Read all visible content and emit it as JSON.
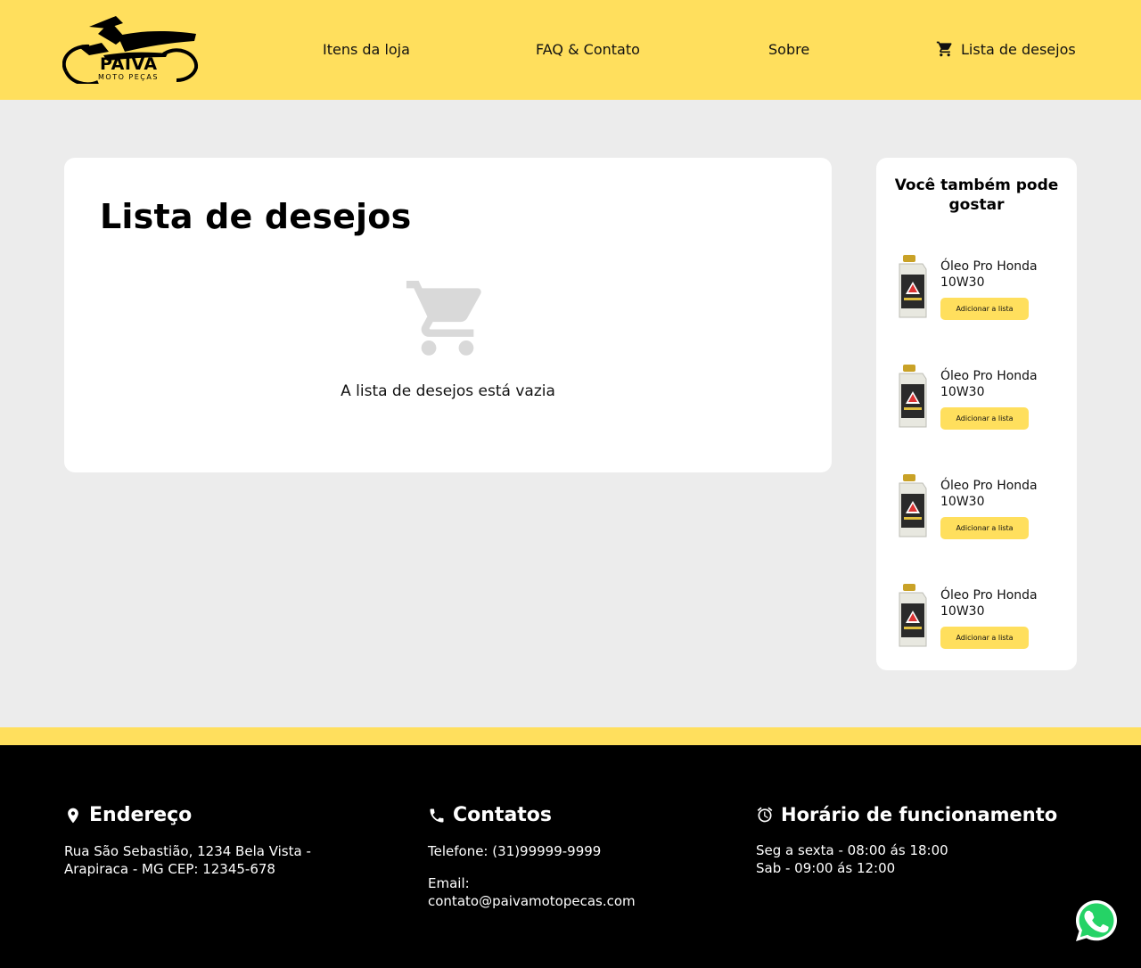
{
  "header": {
    "logo_text": "PAIVA",
    "logo_subtext": "MOTO PEÇAS",
    "nav": [
      {
        "label": "Itens da loja"
      },
      {
        "label": "FAQ & Contato"
      },
      {
        "label": "Sobre"
      },
      {
        "label": "Lista de desejos",
        "icon": "cart-icon"
      }
    ]
  },
  "main": {
    "title": "Lista de desejos",
    "empty_icon": "cart-icon",
    "empty_message": "A lista de desejos está vazia"
  },
  "sidebar": {
    "title": "Você também pode gostar",
    "products": [
      {
        "name": "Óleo Pro Honda 10W30",
        "button": "Adicionar a lista"
      },
      {
        "name": "Óleo Pro Honda 10W30",
        "button": "Adicionar a lista"
      },
      {
        "name": "Óleo Pro Honda 10W30",
        "button": "Adicionar a lista"
      },
      {
        "name": "Óleo Pro Honda 10W30",
        "button": "Adicionar a lista"
      }
    ]
  },
  "footer": {
    "address": {
      "icon": "location-pin-icon",
      "title": "Endereço",
      "text": "Rua São Sebastião, 1234 Bela Vista - Arapiraca - MG CEP: 12345-678"
    },
    "contacts": {
      "icon": "phone-icon",
      "title": "Contatos",
      "phone": "Telefone: (31)99999-9999",
      "email_label": "Email:",
      "email": "contato@paivamotopecas.com"
    },
    "hours": {
      "icon": "alarm-clock-icon",
      "title": "Horário de funcionamento",
      "weekdays": "Seg a sexta - 08:00 ás 18:00",
      "saturday": "Sab - 09:00 ás 12:00"
    }
  },
  "floating": {
    "icon": "whatsapp-icon"
  },
  "colors": {
    "accent": "#ffdf5d",
    "background": "#ececec",
    "footer": "#000000",
    "empty_icon": "#d9d9d9"
  }
}
